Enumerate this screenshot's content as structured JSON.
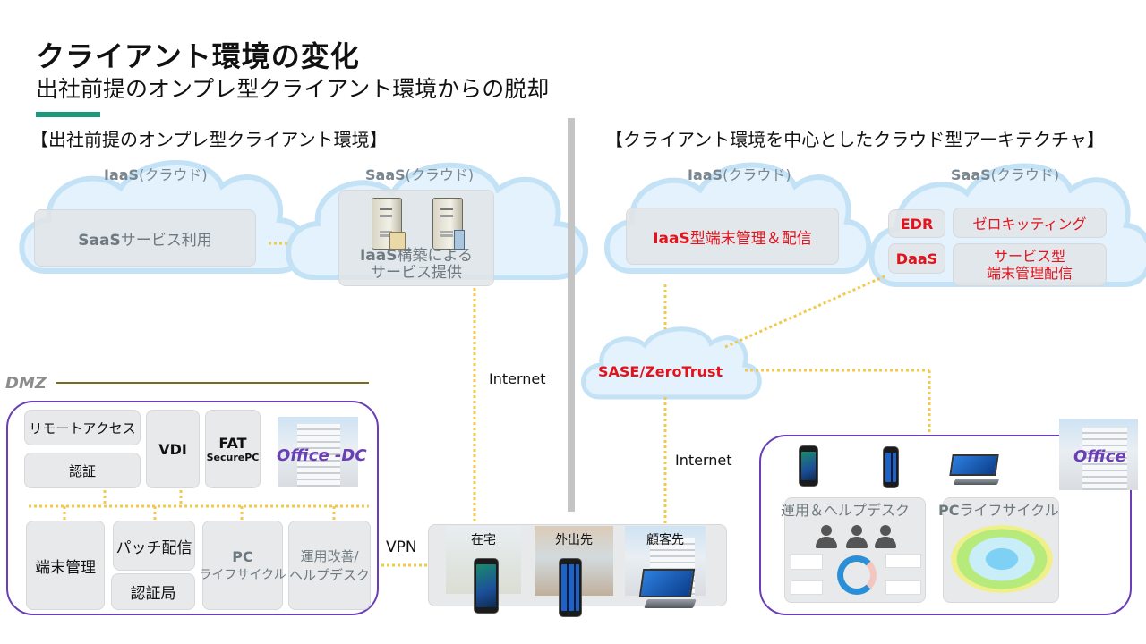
{
  "header": {
    "title": "クライアント環境の変化",
    "subtitle": "出社前提のオンプレ型クライアント環境からの脱却"
  },
  "colors": {
    "accent": "#1a9a7d",
    "frame": "#6a3fb5",
    "highlight_text": "#e3121b",
    "connector": "#f2c94c",
    "cloud_fill": "#dff0fb",
    "cloud_stroke": "#bfe0f5"
  },
  "left": {
    "section_title": "【出社前提のオンプレ型クライアント環境】",
    "iaas_cloud": {
      "label_bold": "IaaS",
      "label_thin": "(クラウド)",
      "box_bold": "SaaS",
      "box_text": "サービス利用"
    },
    "saas_cloud": {
      "label_bold": "SaaS",
      "label_thin": "(クラウド)",
      "box_bold": "IaaS",
      "box_line1": "構築による",
      "box_line2": "サービス提供",
      "icons": [
        "server-folder-icon",
        "server-database-icon"
      ]
    },
    "internet_label": "Internet",
    "dmz_label": "DMZ",
    "office_dc_label": "Office -DC",
    "top_boxes": {
      "remote_access": "リモートアクセス",
      "auth": "認証",
      "vdi": "VDI",
      "fat": "FAT",
      "secure_pc": "SecurePC"
    },
    "bottom_boxes": {
      "device_mgmt": "端末管理",
      "patch": "パッチ配信",
      "cert_authority": "認証局",
      "pc": "PC",
      "lifecycle": "ライフサイクル",
      "ops_line1": "運用改善/",
      "ops_line2": "ヘルプデスク"
    },
    "vpn_label": "VPN"
  },
  "locations": [
    {
      "label": "在宅",
      "device": "smartphone-icon"
    },
    {
      "label": "外出先",
      "device": "windows-phone-icon"
    },
    {
      "label": "顧客先",
      "device": "tablet-pc-icon"
    }
  ],
  "right": {
    "section_title": "【クライアント環境を中心としたクラウド型アーキテクチャ】",
    "iaas_cloud": {
      "label_bold": "IaaS",
      "label_thin": "(クラウド)",
      "box_bold": "IaaS",
      "box_text": "型端末管理＆配信"
    },
    "saas_cloud": {
      "label_bold": "SaaS",
      "label_thin": "(クラウド)",
      "edr": "EDR",
      "zero_touch": "ゼロキッティング",
      "daas": "DaaS",
      "service_line1": "サービス型",
      "service_line2": "端末管理配信"
    },
    "sase_label": "SASE/ZeroTrust",
    "internet_label": "Internet",
    "office_label": "Office",
    "ops_helpdesk_label": "運用＆ヘルプデスク",
    "pc_lifecycle_bold": "PC",
    "pc_lifecycle_text": "ライフサイクル"
  }
}
